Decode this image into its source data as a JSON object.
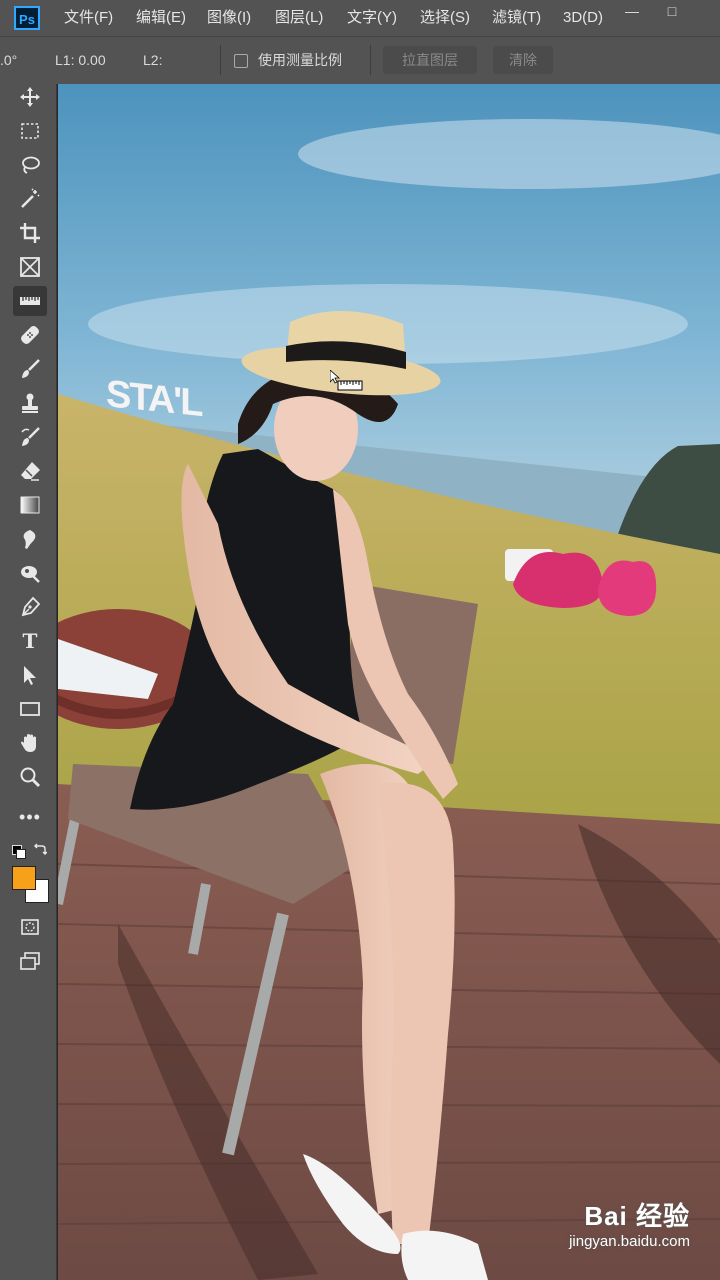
{
  "app": {
    "logo": "Ps"
  },
  "menu": [
    {
      "label": "文件(F)"
    },
    {
      "label": "编辑(E)"
    },
    {
      "label": "图像(I)"
    },
    {
      "label": "图层(L)"
    },
    {
      "label": "文字(Y)"
    },
    {
      "label": "选择(S)"
    },
    {
      "label": "滤镜(T)"
    },
    {
      "label": "3D(D)"
    }
  ],
  "window_controls": {
    "minimize": "—",
    "maximize": "□"
  },
  "options": {
    "angle": ".0°",
    "l1": "L1: 0.00",
    "l2": "L2:",
    "use_scale": "使用测量比例",
    "straighten": "拉直图层",
    "clear": "清除"
  },
  "tools": [
    {
      "icon": "move-icon"
    },
    {
      "icon": "marquee-icon"
    },
    {
      "icon": "lasso-icon"
    },
    {
      "icon": "magic-wand-icon"
    },
    {
      "icon": "crop-icon"
    },
    {
      "icon": "frame-icon"
    },
    {
      "icon": "ruler-icon",
      "active": true
    },
    {
      "icon": "healing-brush-icon"
    },
    {
      "icon": "brush-icon"
    },
    {
      "icon": "clone-stamp-icon"
    },
    {
      "icon": "history-brush-icon"
    },
    {
      "icon": "eraser-icon"
    },
    {
      "icon": "gradient-icon"
    },
    {
      "icon": "blur-icon"
    },
    {
      "icon": "dodge-icon"
    },
    {
      "icon": "pen-icon"
    },
    {
      "icon": "type-icon"
    },
    {
      "icon": "path-selection-icon"
    },
    {
      "icon": "rectangle-icon"
    },
    {
      "icon": "hand-icon"
    },
    {
      "icon": "zoom-icon"
    },
    {
      "icon": "more-tools-icon"
    }
  ],
  "type_tool_glyph": "T",
  "more_glyph": "•••",
  "colors": {
    "foreground": "#f7a11a",
    "background": "#ffffff",
    "accent": "#31a8ff"
  },
  "canvas": {
    "sign_text": "STA'L"
  },
  "watermark": {
    "brand": "Bai 经验",
    "url": "jingyan.baidu.com"
  }
}
